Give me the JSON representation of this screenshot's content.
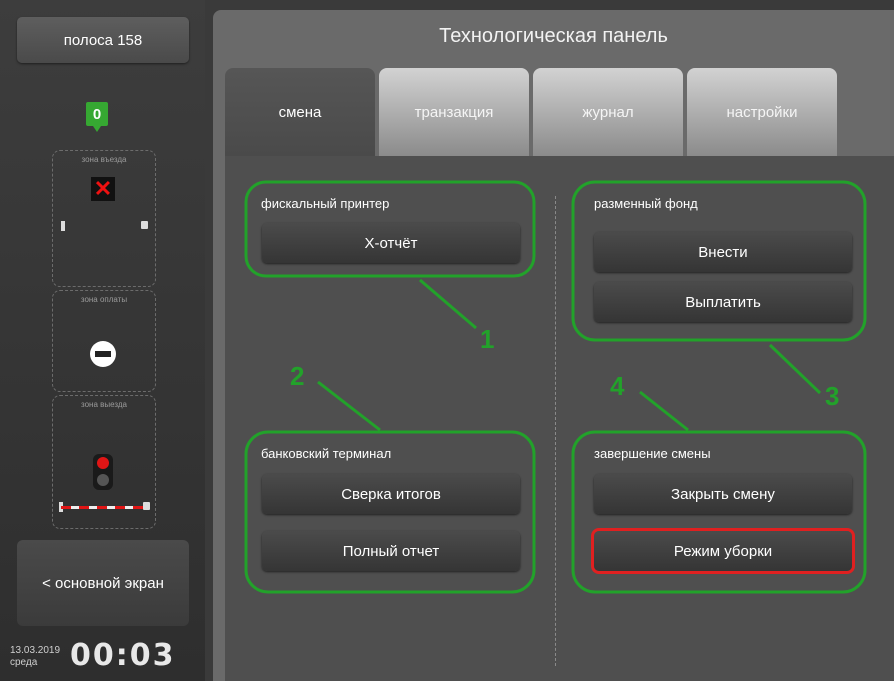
{
  "sidebar": {
    "lane_label": "полоса 158",
    "counter": "0",
    "zones": {
      "entry": "зона въезда",
      "payment": "зона оплаты",
      "exit": "зона выезда"
    },
    "back_button": "< основной экран",
    "date": "13.03.2019",
    "weekday": "среда",
    "time": "00:03"
  },
  "panel": {
    "title": "Технологическая панель",
    "tabs": [
      {
        "label": "смена",
        "active": true
      },
      {
        "label": "транзакция"
      },
      {
        "label": "журнал"
      },
      {
        "label": "настройки"
      }
    ]
  },
  "sections": {
    "fiscal": {
      "title": "фискальный принтер",
      "buttons": [
        "Х-отчёт"
      ]
    },
    "change_fund": {
      "title": "разменный фонд",
      "buttons": [
        "Внести",
        "Выплатить"
      ]
    },
    "bank": {
      "title": "банковский терминал",
      "buttons": [
        "Сверка итогов",
        "Полный отчет"
      ]
    },
    "shift_end": {
      "title": "завершение смены",
      "buttons": [
        "Закрыть смену",
        "Режим уборки"
      ]
    }
  },
  "annotations": [
    "1",
    "2",
    "3",
    "4"
  ],
  "colors": {
    "annotation": "#22a22a",
    "highlight": "#e02020",
    "counter": "#36a832"
  }
}
